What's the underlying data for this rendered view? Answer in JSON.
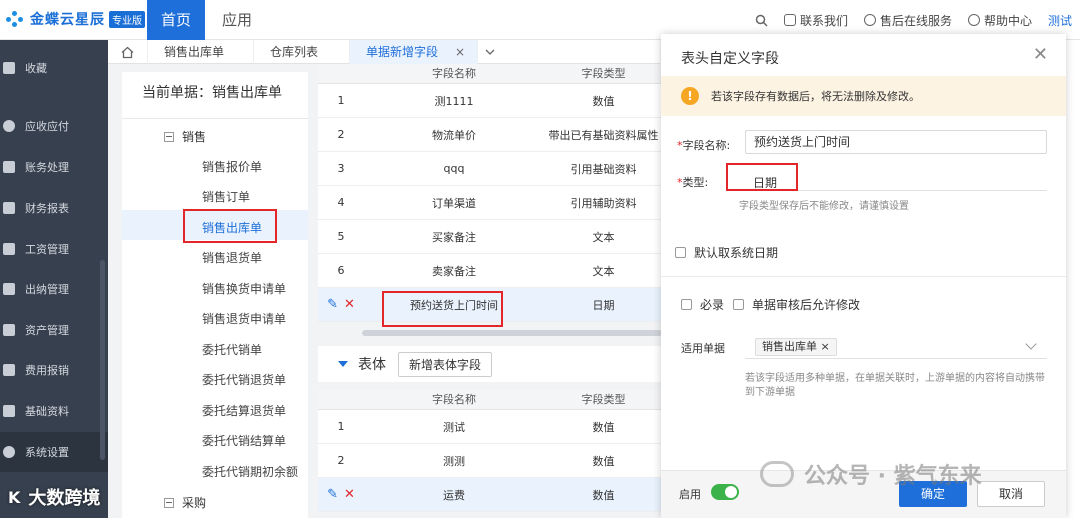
{
  "topbar": {
    "logo_text": "金蝶云星辰",
    "logo_badge": "专业版",
    "nav_home": "首页",
    "nav_app": "应用",
    "links": [
      "联系我们",
      "售后在线服务",
      "帮助中心"
    ],
    "user": "测试"
  },
  "sidebar": {
    "items": [
      "收藏",
      "应收应付",
      "账务处理",
      "财务报表",
      "工资管理",
      "出纳管理",
      "资产管理",
      "费用报销",
      "基础资料",
      "系统设置"
    ]
  },
  "tabs": [
    "销售出库单",
    "仓库列表",
    "单据新增字段"
  ],
  "tree": {
    "current_label": "当前单据：销售出库单",
    "group": "销售",
    "items": [
      "销售报价单",
      "销售订单",
      "销售出库单",
      "销售退货单",
      "销售换货申请单",
      "销售退货申请单",
      "委托代销单",
      "委托代销退货单",
      "委托结算退货单",
      "委托代销结算单",
      "委托代销期初余额"
    ],
    "group2": "采购"
  },
  "header_table": {
    "columns": [
      "",
      "字段名称",
      "字段类型"
    ],
    "rows": [
      {
        "no": "1",
        "name": "测1111",
        "type": "数值"
      },
      {
        "no": "2",
        "name": "物流单价",
        "type": "带出已有基础资料属性"
      },
      {
        "no": "3",
        "name": "qqq",
        "type": "引用基础资料"
      },
      {
        "no": "4",
        "name": "订单渠道",
        "type": "引用辅助资料"
      },
      {
        "no": "5",
        "name": "买家备注",
        "type": "文本"
      },
      {
        "no": "6",
        "name": "卖家备注",
        "type": "文本"
      },
      {
        "no": "",
        "name": "预约送货上门时间",
        "type": "日期"
      }
    ]
  },
  "body_section": {
    "label": "表体",
    "add_button": "新增表体字段"
  },
  "body_table": {
    "columns": [
      "",
      "字段名称",
      "字段类型"
    ],
    "rows": [
      {
        "no": "1",
        "name": "测试",
        "type": "数值"
      },
      {
        "no": "2",
        "name": "测测",
        "type": "数值"
      },
      {
        "no": "",
        "name": "运费",
        "type": "数值"
      }
    ]
  },
  "dialog": {
    "title": "表头自定义字段",
    "warning": "若该字段存有数据后，将无法删除及修改。",
    "field_name_label": "字段名称:",
    "field_name_value": "预约送货上门时间",
    "type_label": "类型:",
    "type_value": "日期",
    "type_hint": "字段类型保存后不能修改，请谨慎设置",
    "default_date_label": "默认取系统日期",
    "required_label": "必录",
    "allow_modify_label": "单据审核后允许修改",
    "applicable_label": "适用单据",
    "applicable_tag": "销售出库单",
    "applicable_hint": "若该字段适用多种单据，在单据关联时，上游单据的内容将自动携带到下游单据",
    "enable_label": "启用",
    "ok": "确定",
    "cancel": "取消"
  },
  "watermarks": {
    "left": "大数跨境",
    "right": "公众号 · 紫气东来"
  },
  "colors": {
    "primary": "#1e6fd9",
    "sidebar_bg": "#37404e",
    "highlight_red": "#e2262a",
    "warning": "#f5a623",
    "toggle_on": "#3cb34a"
  }
}
